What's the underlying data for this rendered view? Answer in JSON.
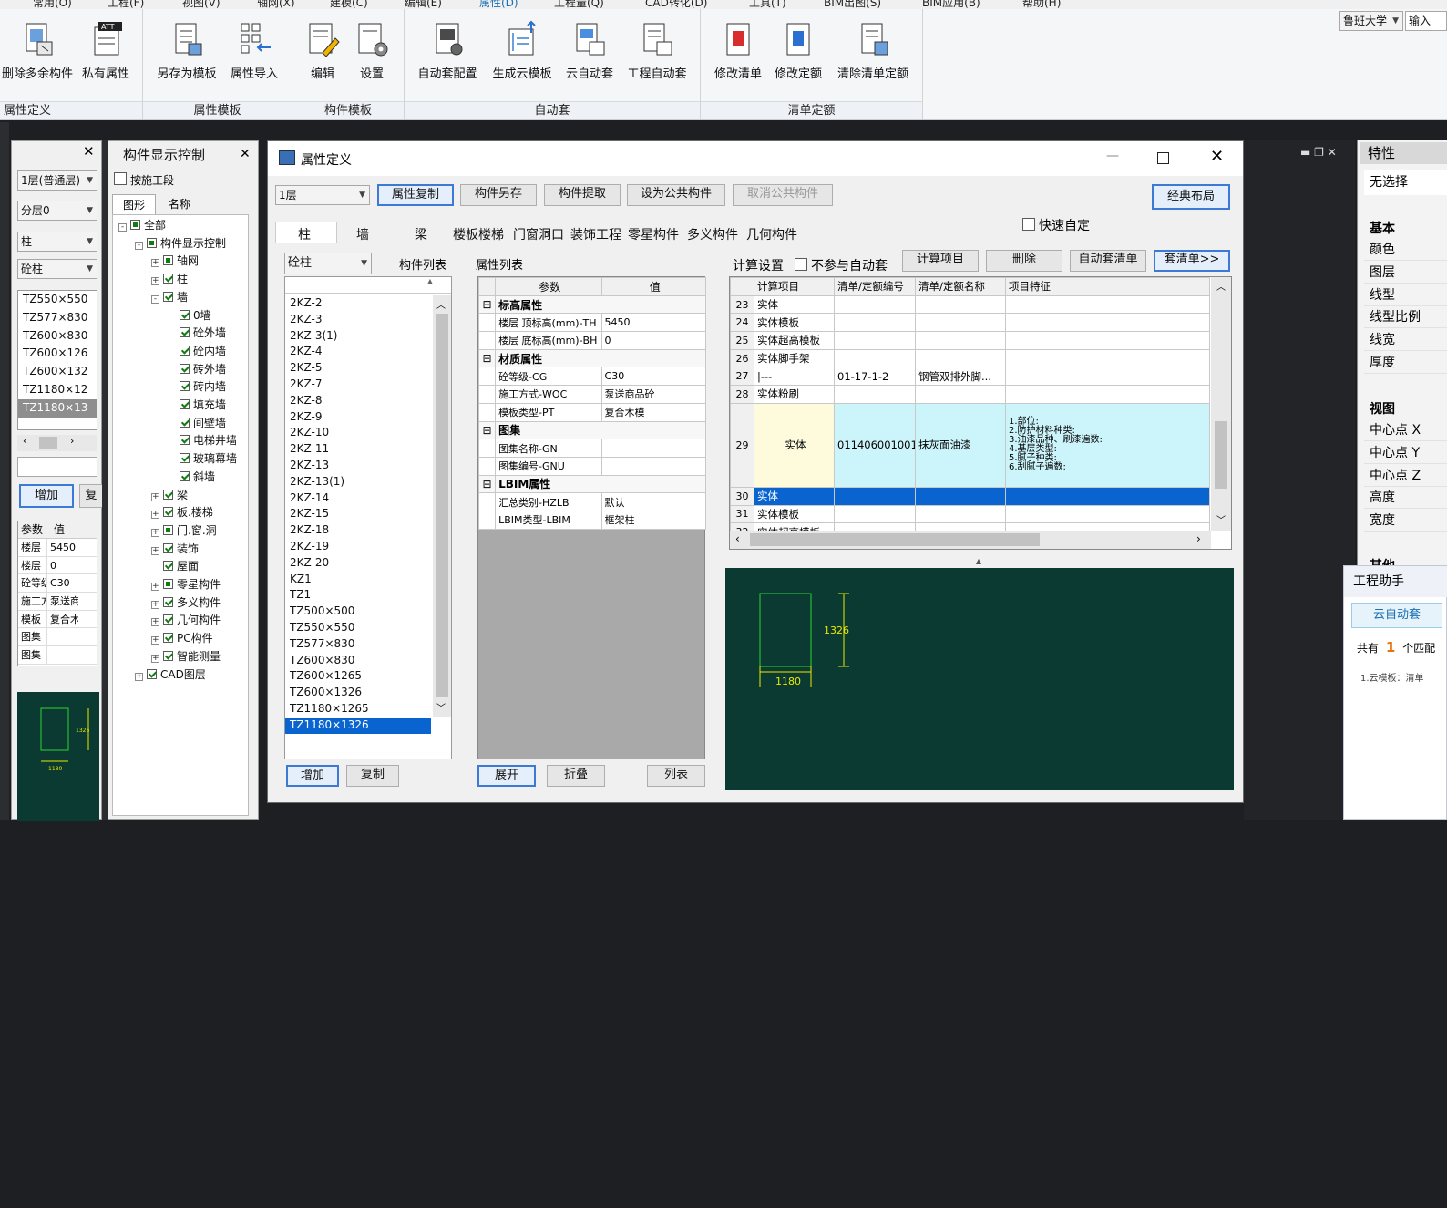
{
  "menubar": [
    "常用(O)",
    "工程(F)",
    "视图(V)",
    "轴网(X)",
    "建模(C)",
    "编辑(E)",
    "属性(D)",
    "工程量(Q)",
    "CAD转化(D)",
    "工具(T)",
    "BIM出图(S)",
    "BIM应用(B)",
    "帮助(H)"
  ],
  "ribbon": {
    "buttons": [
      "删除多余构件",
      "私有属性",
      "另存为模板",
      "属性导入",
      "编辑",
      "设置",
      "自动套配置",
      "生成云模板",
      "云自动套",
      "工程自动套",
      "修改清单",
      "修改定额",
      "清除清单定额"
    ],
    "groups": [
      "属性定义",
      "属性模板",
      "构件模板",
      "自动套",
      "清单定额"
    ],
    "top_right_combo": "鲁班大学",
    "top_right_input": "输入"
  },
  "left_panel": {
    "combos": [
      "1层(普通层)",
      "分层0",
      "柱",
      "砼柱"
    ],
    "items": [
      "TZ550×550",
      "TZ577×830",
      "TZ600×830",
      "TZ600×126",
      "TZ600×132",
      "TZ1180×12",
      "TZ1180×13"
    ],
    "selected": 6,
    "add": "增加",
    "copy_partial": "复",
    "param_header": [
      "参数",
      "值"
    ],
    "params": [
      [
        "楼层",
        "5450"
      ],
      [
        "楼层",
        "0"
      ],
      [
        "砼等级",
        "C30"
      ],
      [
        "施工方",
        "泵送商"
      ],
      [
        "模板",
        "复合木"
      ],
      [
        "图集",
        ""
      ],
      [
        "图集",
        ""
      ]
    ],
    "preview_label_h": "1326",
    "preview_label_w": "1180"
  },
  "display_panel": {
    "title": "构件显示控制",
    "by_section": "按施工段",
    "tabs": [
      "图形",
      "名称"
    ],
    "tree": [
      {
        "label": "全部",
        "indent": 0,
        "exp": "-",
        "cb": "part"
      },
      {
        "label": "构件显示控制",
        "indent": 1,
        "exp": "-",
        "cb": "part"
      },
      {
        "label": "轴网",
        "indent": 2,
        "exp": "+",
        "cb": "part"
      },
      {
        "label": "柱",
        "indent": 2,
        "exp": "+",
        "cb": "on"
      },
      {
        "label": "墙",
        "indent": 2,
        "exp": "-",
        "cb": "on"
      },
      {
        "label": "0墙",
        "indent": 3,
        "exp": "",
        "cb": "on"
      },
      {
        "label": "砼外墙",
        "indent": 3,
        "exp": "",
        "cb": "on"
      },
      {
        "label": "砼内墙",
        "indent": 3,
        "exp": "",
        "cb": "on"
      },
      {
        "label": "砖外墙",
        "indent": 3,
        "exp": "",
        "cb": "on"
      },
      {
        "label": "砖内墙",
        "indent": 3,
        "exp": "",
        "cb": "on"
      },
      {
        "label": "填充墙",
        "indent": 3,
        "exp": "",
        "cb": "on"
      },
      {
        "label": "间壁墙",
        "indent": 3,
        "exp": "",
        "cb": "on"
      },
      {
        "label": "电梯井墙",
        "indent": 3,
        "exp": "",
        "cb": "on"
      },
      {
        "label": "玻璃幕墙",
        "indent": 3,
        "exp": "",
        "cb": "on"
      },
      {
        "label": "斜墙",
        "indent": 3,
        "exp": "",
        "cb": "on"
      },
      {
        "label": "梁",
        "indent": 2,
        "exp": "+",
        "cb": "on"
      },
      {
        "label": "板.楼梯",
        "indent": 2,
        "exp": "+",
        "cb": "on"
      },
      {
        "label": "门.窗.洞",
        "indent": 2,
        "exp": "+",
        "cb": "part"
      },
      {
        "label": "装饰",
        "indent": 2,
        "exp": "+",
        "cb": "on"
      },
      {
        "label": "屋面",
        "indent": 2,
        "exp": "",
        "cb": "on"
      },
      {
        "label": "零星构件",
        "indent": 2,
        "exp": "+",
        "cb": "part"
      },
      {
        "label": "多义构件",
        "indent": 2,
        "exp": "+",
        "cb": "on"
      },
      {
        "label": "几何构件",
        "indent": 2,
        "exp": "+",
        "cb": "on"
      },
      {
        "label": "PC构件",
        "indent": 2,
        "exp": "+",
        "cb": "on"
      },
      {
        "label": "智能测量",
        "indent": 2,
        "exp": "+",
        "cb": "on"
      },
      {
        "label": "CAD图层",
        "indent": 1,
        "exp": "+",
        "cb": "on"
      }
    ]
  },
  "dialog": {
    "title": "属性定义",
    "floor": "1层",
    "toolbar": [
      "属性复制",
      "构件另存",
      "构件提取",
      "设为公共构件",
      "取消公共构件"
    ],
    "classic_layout": "经典布局",
    "quick_custom": "快速自定",
    "tabs": [
      "柱",
      "墙",
      "梁",
      "楼板楼梯",
      "门窗洞口",
      "装饰工程",
      "零星构件",
      "多义构件",
      "几何构件"
    ],
    "category": "砼柱",
    "component_list_label": "构件列表",
    "components": [
      "2KZ-2",
      "2KZ-3",
      "2KZ-3(1)",
      "2KZ-4",
      "2KZ-5",
      "2KZ-7",
      "2KZ-8",
      "2KZ-9",
      "2KZ-10",
      "2KZ-11",
      "2KZ-13",
      "2KZ-13(1)",
      "2KZ-14",
      "2KZ-15",
      "2KZ-18",
      "2KZ-19",
      "2KZ-20",
      "KZ1",
      "TZ1",
      "TZ500×500",
      "TZ550×550",
      "TZ577×830",
      "TZ600×830",
      "TZ600×1265",
      "TZ600×1326",
      "TZ1180×1265",
      "TZ1180×1326"
    ],
    "component_selected": 26,
    "add": "增加",
    "copy": "复制",
    "attr_list_label": "属性列表",
    "attr_header": [
      "参数",
      "值"
    ],
    "attr_rows": [
      {
        "sec": true,
        "name": "标高属性"
      },
      {
        "name": "楼层 顶标高(mm)-TH",
        "value": "5450"
      },
      {
        "name": "楼层 底标高(mm)-BH",
        "value": "0"
      },
      {
        "sec": true,
        "name": "材质属性"
      },
      {
        "name": "砼等级-CG",
        "value": "C30"
      },
      {
        "name": "施工方式-WOC",
        "value": "泵送商品砼"
      },
      {
        "name": "模板类型-PT",
        "value": "复合木模"
      },
      {
        "sec": true,
        "name": "图集"
      },
      {
        "name": "图集名称-GN",
        "value": ""
      },
      {
        "name": "图集编号-GNU",
        "value": ""
      },
      {
        "sec": true,
        "name": "LBIM属性"
      },
      {
        "name": "汇总类别-HZLB",
        "value": "默认"
      },
      {
        "name": "LBIM类型-LBIM",
        "value": "框架柱"
      }
    ],
    "expand": "展开",
    "collapse": "折叠",
    "list_btn": "列表",
    "calc_settings": "计算设置",
    "no_auto": "不参与自动套",
    "calc_item_btn": "计算项目",
    "delete_btn": "删除",
    "auto_list_btn": "自动套清单",
    "apply_list_btn": "套清单>>",
    "calc_header": [
      "计算项目",
      "清单/定额编号",
      "清单/定额名称",
      "项目特征"
    ],
    "calc_rows": [
      {
        "n": "23",
        "item": "实体",
        "code": "",
        "name": "",
        "feat": ""
      },
      {
        "n": "24",
        "item": "实体模板",
        "code": "",
        "name": "",
        "feat": ""
      },
      {
        "n": "25",
        "item": "实体超高模板",
        "code": "",
        "name": "",
        "feat": ""
      },
      {
        "n": "26",
        "item": "实体脚手架",
        "code": "",
        "name": "",
        "feat": ""
      },
      {
        "n": "27",
        "item": "|---",
        "code": "01-17-1-2",
        "name": "钢管双排外脚...",
        "feat": ""
      },
      {
        "n": "28",
        "item": "实体粉刷",
        "code": "",
        "name": "",
        "feat": ""
      },
      {
        "n": "29",
        "item": "实体",
        "code": "011406001001",
        "name": "抹灰面油漆",
        "feat": "1.部位:\n2.防护材料种类:\n3.油漆品种、刷漆遍数:\n4.基层类型:\n5.腻子种类:\n6.刮腻子遍数:"
      },
      {
        "n": "30",
        "item": "实体",
        "code": "",
        "name": "",
        "feat": ""
      },
      {
        "n": "31",
        "item": "实体模板",
        "code": "",
        "name": "",
        "feat": ""
      },
      {
        "n": "32",
        "item": "实体超高模板",
        "code": "",
        "name": "",
        "feat": ""
      }
    ],
    "preview_h": "1326",
    "preview_w": "1180"
  },
  "right_panel": {
    "title": "特性",
    "no_selection": "无选择",
    "basic": "基本",
    "basic_items": [
      "颜色",
      "图层",
      "线型",
      "线型比例",
      "线宽",
      "厚度"
    ],
    "view": "视图",
    "view_items": [
      "中心点 X",
      "中心点 Y",
      "中心点 Z",
      "高度",
      "宽度"
    ],
    "other": "其他",
    "assistant": "工程助手",
    "cloud_auto": "云自动套",
    "total_prefix": "共有",
    "total_count": "1",
    "total_suffix": "个匹配",
    "cloud_line": "1.云模板：清单"
  }
}
